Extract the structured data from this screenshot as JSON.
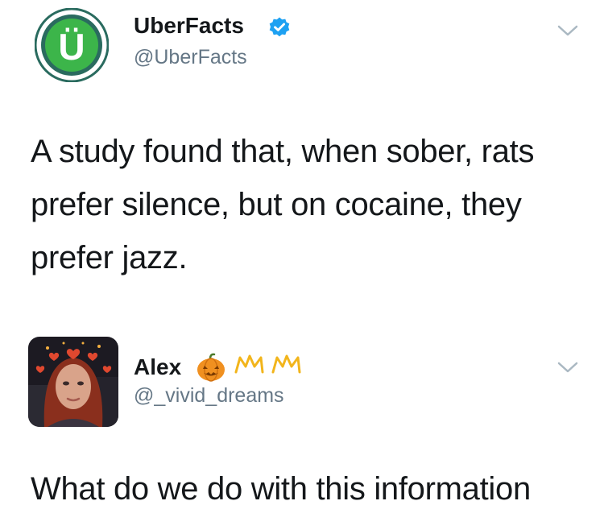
{
  "tweets": [
    {
      "display_name": "UberFacts",
      "handle": "@UberFacts",
      "verified": true,
      "avatar_icon": "uberfacts-logo-icon",
      "avatar_letter": "Ü",
      "text": "A study found that, when sober, rats prefer silence, but on cocaine, they prefer jazz."
    },
    {
      "display_name": "Alex",
      "handle": "@_vivid_dreams",
      "verified": false,
      "avatar_icon": "profile-photo",
      "name_emojis": [
        "pumpkin-icon",
        "crown-icon",
        "crown-icon"
      ],
      "text": "What do we do with this information"
    }
  ],
  "colors": {
    "text": "#14171a",
    "handle": "#657786",
    "verified_blue": "#1da1f2",
    "uberfacts_green": "#3cb54a",
    "uberfacts_ring": "#2a6b5f",
    "chevron": "#aab8c2"
  },
  "icons": {
    "verified": "verified-badge-icon",
    "more": "chevron-down-icon"
  }
}
